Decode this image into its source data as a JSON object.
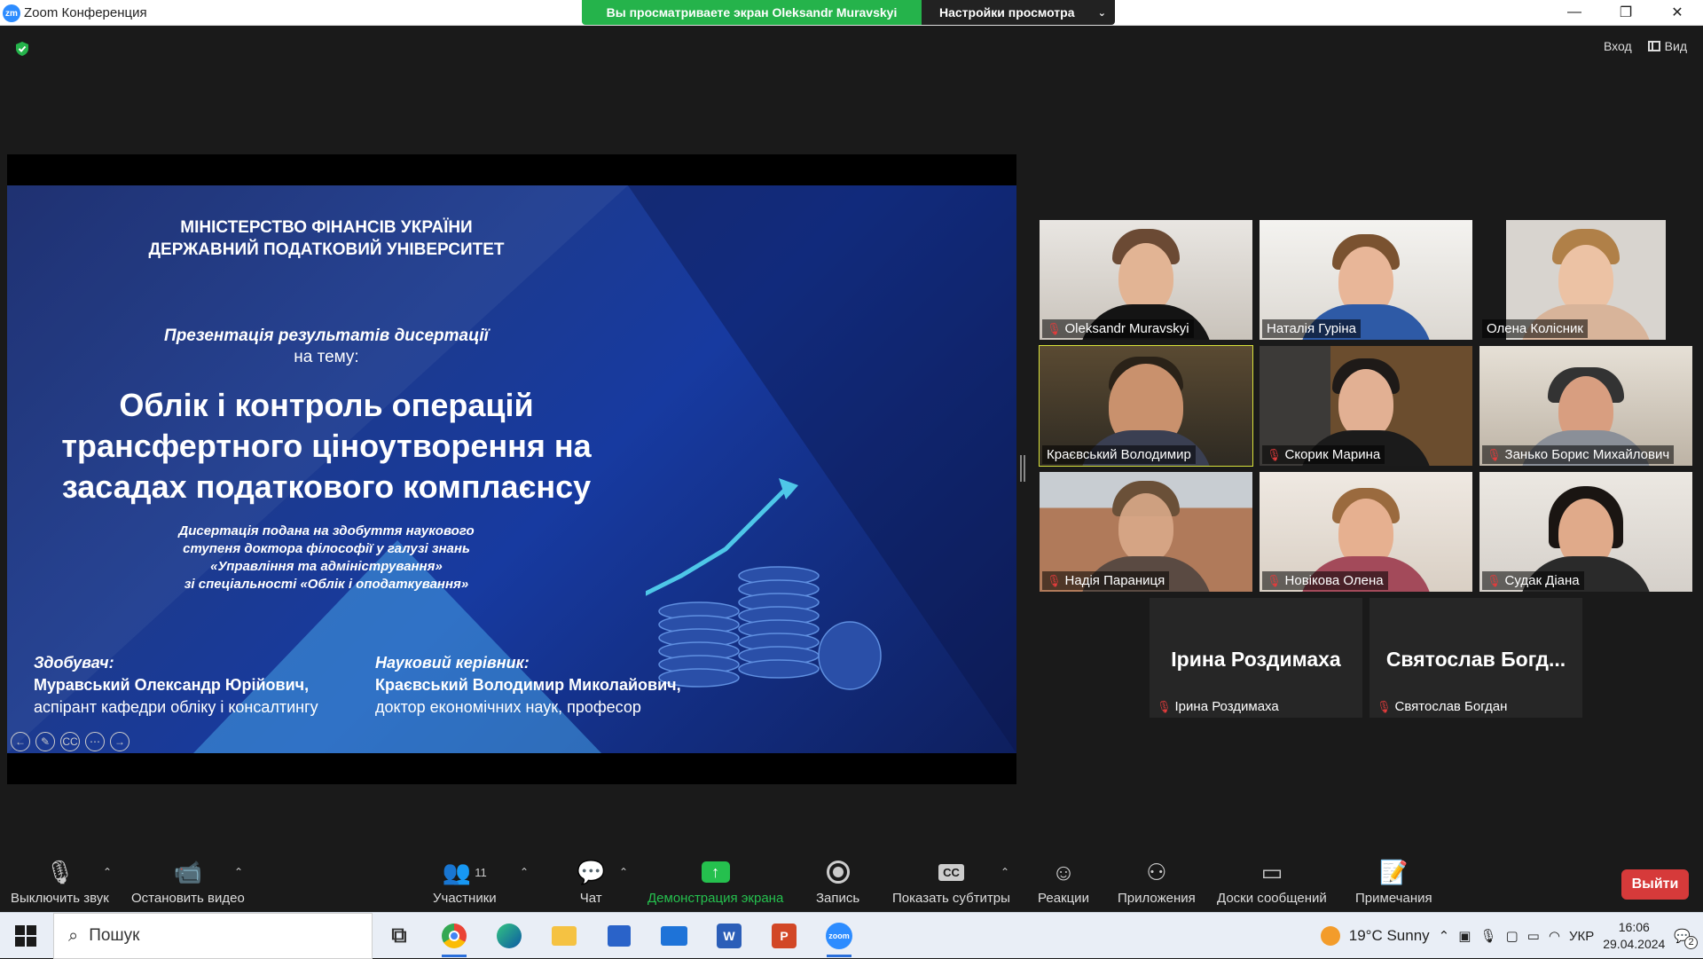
{
  "window": {
    "app_logo": "zm",
    "title": "Zoom Конференция",
    "share_banner": "Вы просматриваете экран Oleksandr Muravskyi",
    "view_options": "Настройки просмотра",
    "minimize": "—",
    "restore": "❐",
    "close": "✕"
  },
  "top_right": {
    "sign_in": "Вход",
    "view": "Вид"
  },
  "slide": {
    "ministry_line1": "МІНІСТЕРСТВО ФІНАНСІВ УКРАЇНИ",
    "ministry_line2": "ДЕРЖАВНИЙ ПОДАТКОВИЙ УНІВЕРСИТЕТ",
    "presentation": "Презентація результатів дисертації",
    "on_topic": "на тему:",
    "title_line1": "Облік і контроль операцій",
    "title_line2": "трансфертного ціноутворення на",
    "title_line3": "засадах податкового комплаєнсу",
    "desc_line1": "Дисертація подана на здобуття наукового",
    "desc_line2": "ступеня доктора філософії у галузі знань",
    "desc_line3": "«Управління та адміністрування»",
    "desc_line4": "зі спеціальності «Облік і оподаткування»",
    "applicant_label": "Здобувач:",
    "applicant_name": "Муравський Олександр Юрійович,",
    "applicant_role": "аспірант кафедри обліку і консалтингу",
    "supervisor_label": "Науковий керівник:",
    "supervisor_name": "Краєвський Володимир Миколайович,",
    "supervisor_role": "доктор економічних наук, професор",
    "ctrl_prev": "←",
    "ctrl_pen": "✎",
    "ctrl_cc": "CC",
    "ctrl_more": "⋯",
    "ctrl_next": "→"
  },
  "participants": [
    {
      "name": "Oleksandr Muravskyi",
      "muted": true
    },
    {
      "name": "Наталія Гуріна",
      "muted": false
    },
    {
      "name": "Олена Колісник",
      "muted": false
    },
    {
      "name": "Краєвський Володимир",
      "muted": false,
      "active_speaker": true
    },
    {
      "name": "Скорик Марина",
      "muted": true
    },
    {
      "name": "Занько Борис Михайлович",
      "muted": true
    },
    {
      "name": "Надія Параниця",
      "muted": true
    },
    {
      "name": "Новікова Олена",
      "muted": true
    },
    {
      "name": "Судак Діана",
      "muted": true
    },
    {
      "name": "Ірина Роздимаха",
      "muted": true,
      "display_name": "Ірина Роздимаха"
    },
    {
      "name": "Святослав Богдан",
      "muted": true,
      "display_name": "Святослав  Богд..."
    }
  ],
  "toolbar": {
    "mute": "Выключить звук",
    "video": "Остановить видео",
    "participants": "Участники",
    "participants_count": "11",
    "chat": "Чат",
    "share": "Демонстрация экрана",
    "record": "Запись",
    "captions": "Показать субтитры",
    "captions_icon": "CC",
    "reactions": "Реакции",
    "apps": "Приложения",
    "whiteboards": "Доски сообщений",
    "notes": "Примечания",
    "leave": "Выйти"
  },
  "taskbar": {
    "search_placeholder": "Пошук",
    "word_icon": "W",
    "ppt_icon": "P",
    "zoom_icon": "zoom",
    "weather": "19°C  Sunny",
    "language": "УКР",
    "time": "16:06",
    "date": "29.04.2024",
    "notifications": "2"
  },
  "colors": {
    "share_green": "#25b34b",
    "active_speaker": "#d8e23b",
    "leave_red": "#d63a3a",
    "muted_red": "#e43b3b"
  }
}
